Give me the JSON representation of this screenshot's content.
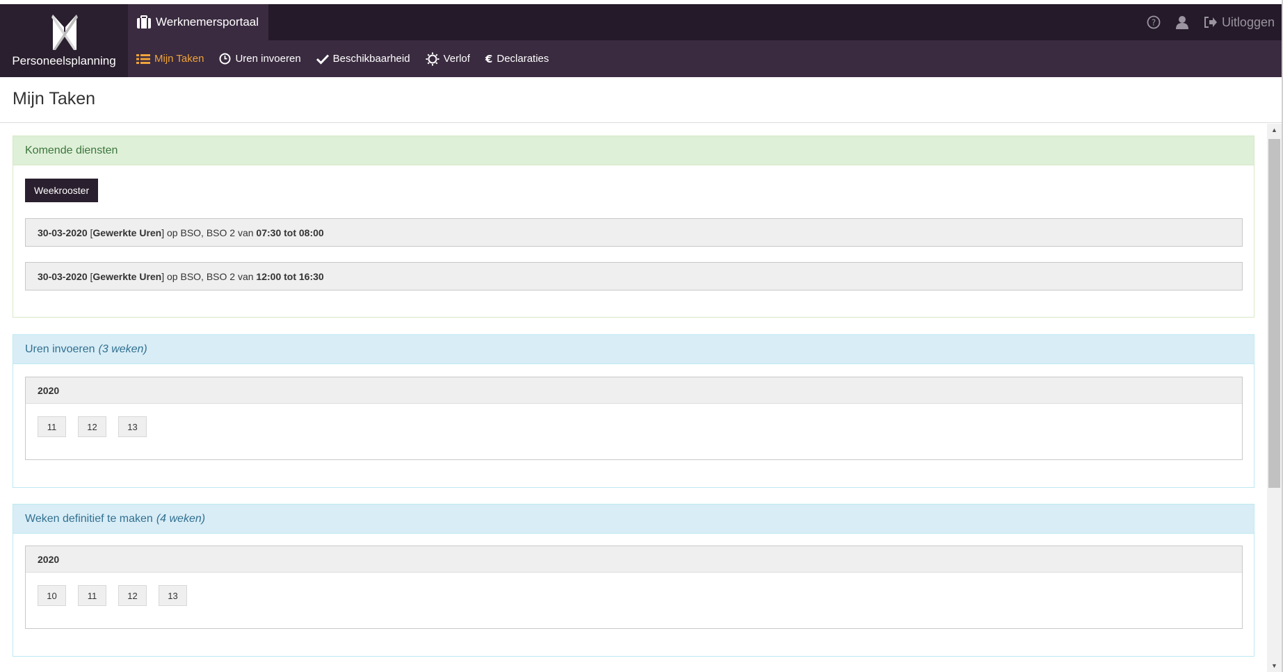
{
  "brand": {
    "name": "Personeelsplanning"
  },
  "portal": {
    "title": "Werknemersportaal"
  },
  "top_right": {
    "help_icon": "question-circle-icon",
    "user_icon": "user-icon",
    "logout_label": "Uitloggen"
  },
  "menu": [
    {
      "label": "Mijn Taken",
      "icon": "tasks-icon",
      "active": true
    },
    {
      "label": "Uren invoeren",
      "icon": "clock-icon",
      "active": false
    },
    {
      "label": "Beschikbaarheid",
      "icon": "check-icon",
      "active": false
    },
    {
      "label": "Verlof",
      "icon": "sun-icon",
      "active": false
    },
    {
      "label": "Declaraties",
      "icon": "euro-icon",
      "active": false
    }
  ],
  "page": {
    "title": "Mijn Taken"
  },
  "komende_diensten": {
    "title": "Komende diensten",
    "button_label": "Weekrooster",
    "shifts": [
      {
        "date": "30-03-2020",
        "type": "Gewerkte Uren",
        "location": "op BSO, BSO 2 van",
        "time": "07:30 tot 08:00"
      },
      {
        "date": "30-03-2020",
        "type": "Gewerkte Uren",
        "location": "op BSO, BSO 2 van",
        "time": "12:00 tot 16:30"
      }
    ]
  },
  "uren_invoeren": {
    "title": "Uren invoeren",
    "count": "(3 weken)",
    "year": "2020",
    "weeks": [
      "11",
      "12",
      "13"
    ]
  },
  "weken_definitief": {
    "title": "Weken definitief te maken",
    "count": "(4 weken)",
    "year": "2020",
    "weeks": [
      "10",
      "11",
      "12",
      "13"
    ]
  },
  "colors": {
    "navbar": "#3a2b40",
    "brand_bg": "#2a1f2e",
    "active_menu": "#f0a43a",
    "panel_success_bg": "#dff0d8",
    "panel_info_bg": "#d9edf7"
  }
}
